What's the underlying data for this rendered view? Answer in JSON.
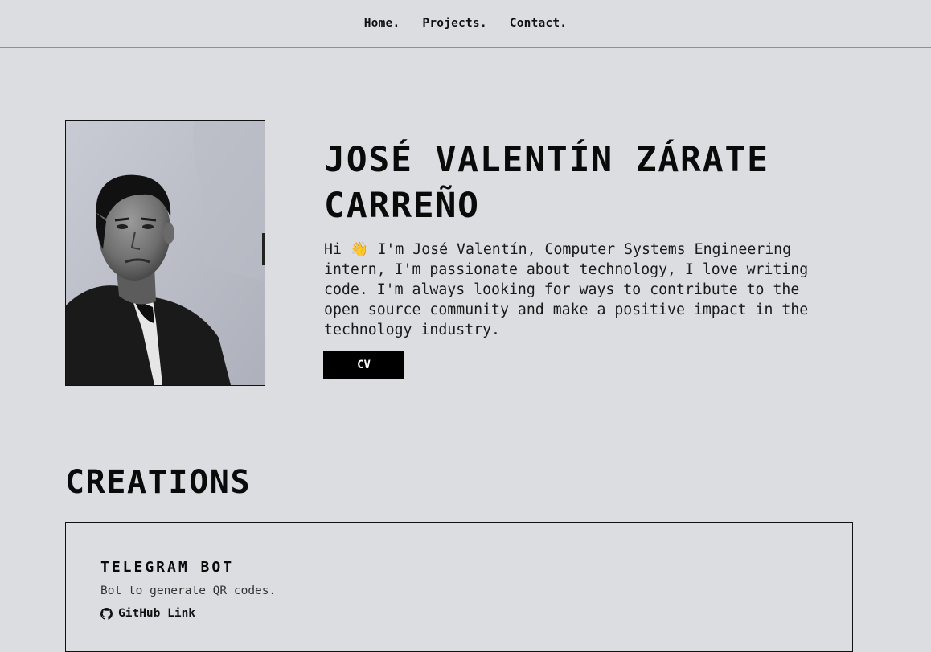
{
  "nav": {
    "items": [
      "Home.",
      "Projects.",
      "Contact."
    ]
  },
  "hero": {
    "name": "JOSÉ VALENTÍN ZÁRATE CARREÑO",
    "bio": "Hi 👋 I'm José Valentín, Computer Systems Engineering intern, I'm passionate about technology, I love writing code. I'm always looking for ways to contribute to the open source community and make a positive impact in the technology industry.",
    "cv_label": "CV"
  },
  "creations": {
    "title": "CREATIONS",
    "projects": [
      {
        "title": "TELEGRAM BOT",
        "description": "Bot to generate QR codes.",
        "link_label": "GitHub Link",
        "link_icon": "github-icon"
      }
    ]
  }
}
